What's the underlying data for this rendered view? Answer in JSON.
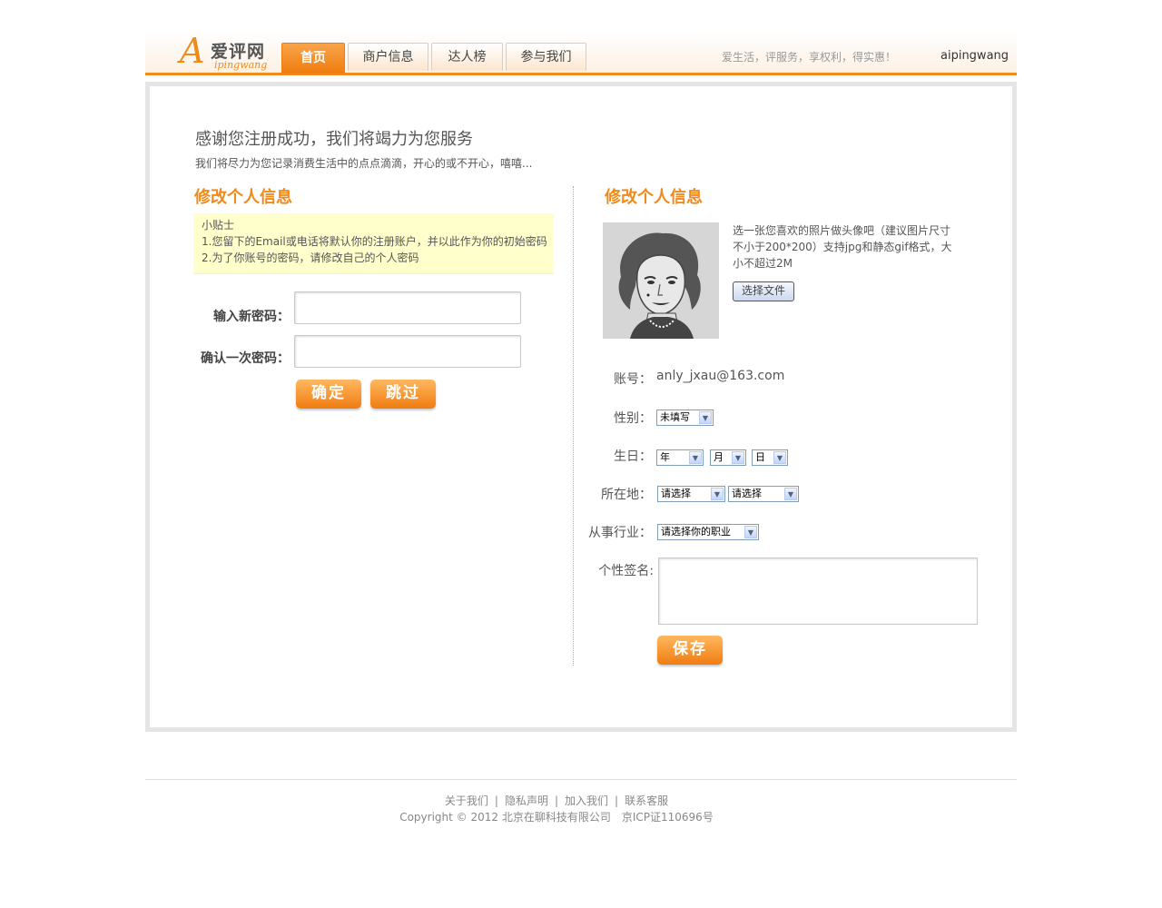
{
  "header": {
    "logo_letter": "A",
    "logo_cn": "爱评网",
    "logo_en": "ipingwang",
    "nav": [
      {
        "label": "首页",
        "active": true
      },
      {
        "label": "商户信息",
        "active": false
      },
      {
        "label": "达人榜",
        "active": false
      },
      {
        "label": "参与我们",
        "active": false
      }
    ],
    "slogan": "爱生活，评服务，享权利，得实惠！",
    "site_name": "aipingwang"
  },
  "welcome": {
    "title": "感谢您注册成功，我们将竭力为您服务",
    "subtitle": "我们将尽力为您记录消费生活中的点点滴滴，开心的或不开心，嘻嘻..."
  },
  "left": {
    "section_title": "修改个人信息",
    "tips": {
      "heading": "小贴士",
      "line1": "1.您留下的Email或电话将默认你的注册账户，并以此作为你的初始密码",
      "line2": "2.为了你账号的密码，请修改自己的个人密码"
    },
    "new_password_label": "输入新密码：",
    "confirm_password_label": "确认一次密码：",
    "confirm_button": "确定",
    "skip_button": "跳过"
  },
  "right": {
    "section_title": "修改个人信息",
    "avatar_note": "选一张您喜欢的照片做头像吧（建议图片尺寸不小于200*200）支持jpg和静态gif格式，大小不超过2M",
    "choose_file_button": "选择文件",
    "account_label": "账号：",
    "account_value": "anly_jxau@163.com",
    "gender_label": "性别：",
    "gender_value": "未填写",
    "birthday_label": "生日：",
    "birthday_year": "年",
    "birthday_month": "月",
    "birthday_day": "日",
    "location_label": "所在地：",
    "province_value": "请选择",
    "city_value": "请选择",
    "industry_label": "从事行业：",
    "industry_value": "请选择你的职业",
    "signature_label": "个性签名:",
    "save_button": "保存"
  },
  "footer": {
    "links": [
      "关于我们",
      "隐私声明",
      "加入我们",
      "联系客服"
    ],
    "separator": "|",
    "copyright": "Copyright © 2012 北京在聊科技有限公司　京ICP证110696号"
  },
  "colors": {
    "accent": "#f08a1a",
    "tips_bg": "#ffffcc",
    "panel_border": "#e5e5e5"
  }
}
